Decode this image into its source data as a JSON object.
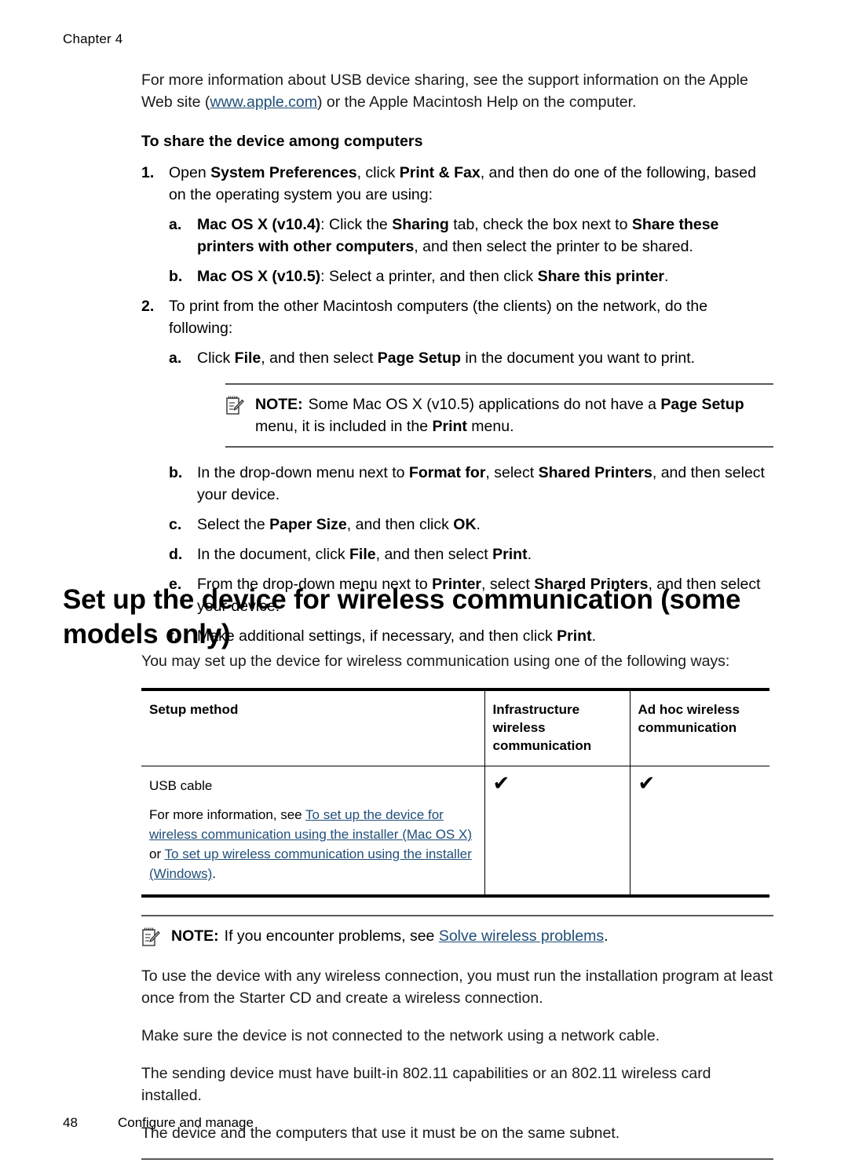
{
  "header": {
    "chapter": "Chapter 4"
  },
  "intro": {
    "text_before_link": "For more information about USB device sharing, see the support information on the Apple Web site (",
    "link": "www.apple.com",
    "text_after_link": ") or the Apple Macintosh Help on the computer."
  },
  "share_section": {
    "heading": "To share the device among computers",
    "step1": {
      "marker": "1.",
      "part1": "Open ",
      "bold1": "System Preferences",
      "part2": ", click ",
      "bold2": "Print & Fax",
      "part3": ", and then do one of the following, based on the operating system you are using:",
      "sub_a": {
        "marker": "a.",
        "bold1": "Mac OS X (v10.4)",
        "part1": ": Click the ",
        "bold2": "Sharing",
        "part2": " tab, check the box next to ",
        "bold3": "Share these printers with other computers",
        "part3": ", and then select the printer to be shared."
      },
      "sub_b": {
        "marker": "b.",
        "bold1": "Mac OS X (v10.5)",
        "part1": ": Select a printer, and then click ",
        "bold2": "Share this printer",
        "part2": "."
      }
    },
    "step2": {
      "marker": "2.",
      "text": "To print from the other Macintosh computers (the clients) on the network, do the following:",
      "sub_a": {
        "marker": "a.",
        "part1": "Click ",
        "bold1": "File",
        "part2": ", and then select ",
        "bold2": "Page Setup",
        "part3": " in the document you want to print."
      },
      "note": {
        "label": "NOTE:",
        "icon": "note-pad-pencil-icon",
        "part1": "Some Mac OS X (v10.5) applications do not have a ",
        "bold1": "Page Setup",
        "part2": " menu, it is included in the ",
        "bold2": "Print",
        "part3": " menu."
      },
      "sub_b": {
        "marker": "b.",
        "part1": "In the drop-down menu next to ",
        "bold1": "Format for",
        "part2": ", select ",
        "bold2": "Shared Printers",
        "part3": ", and then select your device."
      },
      "sub_c": {
        "marker": "c.",
        "part1": "Select the ",
        "bold1": "Paper Size",
        "part2": ", and then click ",
        "bold2": "OK",
        "part3": "."
      },
      "sub_d": {
        "marker": "d.",
        "part1": "In the document, click ",
        "bold1": "File",
        "part2": ", and then select ",
        "bold2": "Print",
        "part3": "."
      },
      "sub_e": {
        "marker": "e.",
        "part1": "From the drop-down menu next to ",
        "bold1": "Printer",
        "part2": ", select ",
        "bold2": "Shared Printers",
        "part3": ", and then select your device."
      },
      "sub_f": {
        "marker": "f.",
        "part1": "Make additional settings, if necessary, and then click ",
        "bold1": "Print",
        "part2": "."
      }
    }
  },
  "wireless_section": {
    "heading": "Set up the device for wireless communication (some models only)",
    "intro": "You may set up the device for wireless communication using one of the following ways:",
    "table": {
      "columns": [
        "Setup method",
        "Infrastructure wireless communication",
        "Ad hoc wireless communication"
      ],
      "rows": [
        {
          "method_title": "USB cable",
          "method_desc_part1": "For more information, see ",
          "method_link1": "To set up the device for wireless communication using the installer (Mac OS X)",
          "method_desc_part2": " or ",
          "method_link2": "To set up wireless communication using the installer (Windows)",
          "method_desc_part3": ".",
          "infrastructure": "✔",
          "adhoc": "✔"
        }
      ]
    },
    "note": {
      "label": "NOTE:",
      "icon": "note-pad-pencil-icon",
      "part1": "If you encounter problems, see ",
      "link": "Solve wireless problems",
      "part2": "."
    },
    "paragraphs": [
      "To use the device with any wireless connection, you must run the installation program at least once from the Starter CD and create a wireless connection.",
      "Make sure the device is not connected to the network using a network cable.",
      "The sending device must have built-in 802.11 capabilities or an 802.11 wireless card installed.",
      "The device and the computers that use it must be on the same subnet."
    ]
  },
  "footer": {
    "page_number": "48",
    "section_name": "Configure and manage"
  },
  "colors": {
    "link": "#1f4e79",
    "rule": "#58595b",
    "text": "#1a1a1a"
  }
}
